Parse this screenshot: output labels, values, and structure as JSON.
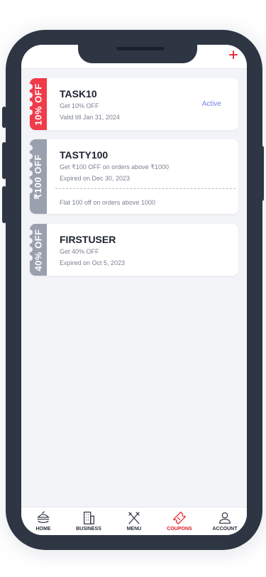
{
  "header": {
    "add_icon": "plus-icon"
  },
  "coupons": [
    {
      "ribbon": "10% OFF",
      "ribbon_color": "#ef3b4a",
      "code": "TASK10",
      "description": "Get 10% OFF",
      "validity": "Valid till Jan 31, 2024",
      "status": "Active"
    },
    {
      "ribbon": "₹100 OFF",
      "ribbon_color": "#9aa0ad",
      "code": "TASTY100",
      "description": "Get ₹100 OFF on orders above ₹1000",
      "validity": "Expired on Dec 30, 2023",
      "note": "Flat 100 off on orders above 1000"
    },
    {
      "ribbon": "40% OFF",
      "ribbon_color": "#9aa0ad",
      "code": "FIRSTUSER",
      "description": "Get 40% OFF",
      "validity": "Expired on Oct 5, 2023"
    }
  ],
  "nav": {
    "items": [
      {
        "label": "HOME",
        "icon": "burger-icon"
      },
      {
        "label": "BUSINESS",
        "icon": "building-icon"
      },
      {
        "label": "MENU",
        "icon": "fork-knife-icon"
      },
      {
        "label": "COUPONS",
        "icon": "ticket-icon",
        "active": true
      },
      {
        "label": "ACCOUNT",
        "icon": "user-icon"
      }
    ],
    "active_color": "#e11b2a"
  }
}
